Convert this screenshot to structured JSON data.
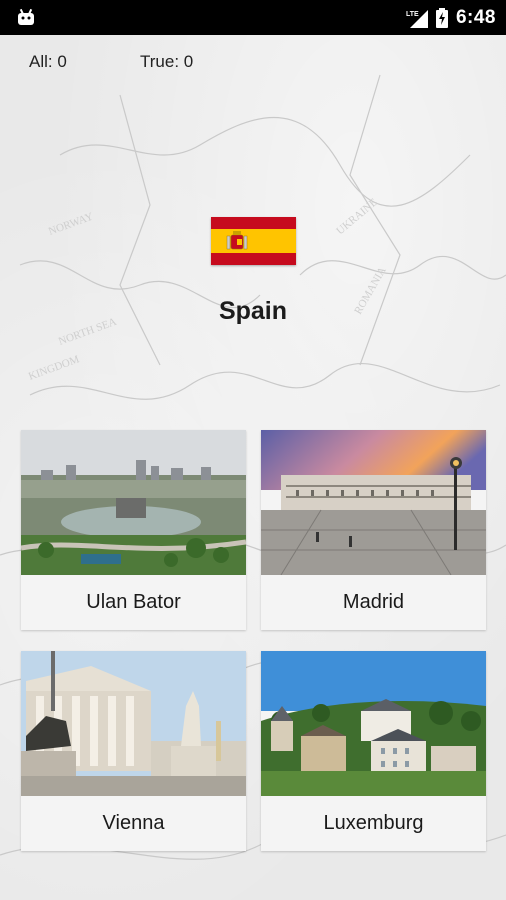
{
  "status_bar": {
    "network": "LTE",
    "time": "6:48"
  },
  "score": {
    "all_label": "All: 0",
    "true_label": "True: 0"
  },
  "question": {
    "country": "Spain",
    "flag_icon": "spain-flag-icon",
    "flag_colors": [
      "#c60b1e",
      "#ffc400",
      "#c60b1e"
    ]
  },
  "answers": [
    {
      "label": "Ulan Bator",
      "image": "ulan-bator-city-photo"
    },
    {
      "label": "Madrid",
      "image": "madrid-royal-palace-photo"
    },
    {
      "label": "Vienna",
      "image": "vienna-parliament-photo"
    },
    {
      "label": "Luxemburg",
      "image": "luxemburg-town-photo"
    }
  ]
}
